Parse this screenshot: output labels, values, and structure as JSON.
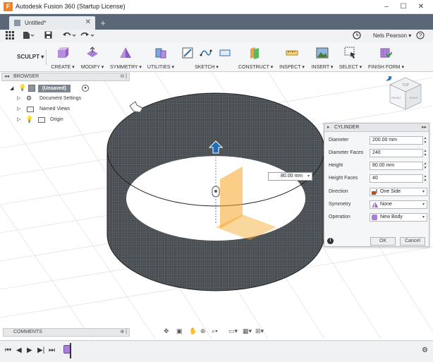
{
  "window": {
    "title": "Autodesk Fusion 360 (Startup License)",
    "app_icon": "F",
    "minimize": "–",
    "maximize": "☐",
    "close": "✕"
  },
  "tab": {
    "label": "Untitled*",
    "close": "✕",
    "new_tab": "+"
  },
  "quick_access": {
    "user": "Nels Pearson ▾",
    "help": "?"
  },
  "toolbar": {
    "workspace": "SCULPT ▾",
    "groups": [
      {
        "label": "CREATE ▾"
      },
      {
        "label": "MODIFY ▾"
      },
      {
        "label": "SYMMETRY ▾"
      },
      {
        "label": "UTILITIES ▾"
      },
      {
        "label": "SKETCH ▾"
      },
      {
        "label": "CONSTRUCT ▾"
      },
      {
        "label": "INSPECT ▾"
      },
      {
        "label": "INSERT ▾"
      },
      {
        "label": "SELECT ▾"
      },
      {
        "label": "FINISH FORM ▾"
      }
    ]
  },
  "browser": {
    "title": "BROWSER",
    "root": "(Unsaved)",
    "items": [
      {
        "label": "Document Settings"
      },
      {
        "label": "Named Views"
      },
      {
        "label": "Origin"
      }
    ]
  },
  "comments": {
    "title": "COMMENTS"
  },
  "viewcube": {
    "top": "TOP",
    "front": "FRONT",
    "right": "RIGHT"
  },
  "dimension_input": {
    "value": "80.00 mm"
  },
  "cylinder_dialog": {
    "title": "CYLINDER",
    "fields": [
      {
        "label": "Diameter",
        "value": "200.00 mm"
      },
      {
        "label": "Diameter Faces",
        "value": "240"
      },
      {
        "label": "Height",
        "value": "80.00 mm"
      },
      {
        "label": "Height Faces",
        "value": "40"
      }
    ],
    "dropdowns": [
      {
        "label": "Direction",
        "value": "One Side"
      },
      {
        "label": "Symmetry",
        "value": "None"
      },
      {
        "label": "Operation",
        "value": "New Body"
      }
    ],
    "ok": "OK",
    "cancel": "Cancel",
    "info": "i"
  },
  "colors": {
    "tabbar": "#5a6776",
    "mesh": "#3a3f44",
    "manipulator": "#1c6fb8",
    "plane": "#f5a623"
  }
}
